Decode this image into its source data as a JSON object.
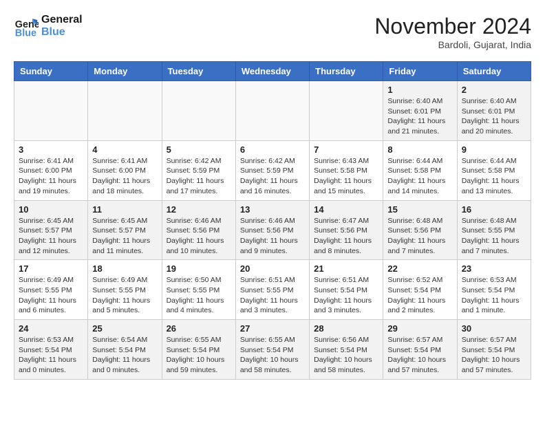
{
  "header": {
    "logo_line1": "General",
    "logo_line2": "Blue",
    "month_title": "November 2024",
    "location": "Bardoli, Gujarat, India"
  },
  "weekdays": [
    "Sunday",
    "Monday",
    "Tuesday",
    "Wednesday",
    "Thursday",
    "Friday",
    "Saturday"
  ],
  "weeks": [
    [
      {
        "day": "",
        "info": ""
      },
      {
        "day": "",
        "info": ""
      },
      {
        "day": "",
        "info": ""
      },
      {
        "day": "",
        "info": ""
      },
      {
        "day": "",
        "info": ""
      },
      {
        "day": "1",
        "info": "Sunrise: 6:40 AM\nSunset: 6:01 PM\nDaylight: 11 hours and 21 minutes."
      },
      {
        "day": "2",
        "info": "Sunrise: 6:40 AM\nSunset: 6:01 PM\nDaylight: 11 hours and 20 minutes."
      }
    ],
    [
      {
        "day": "3",
        "info": "Sunrise: 6:41 AM\nSunset: 6:00 PM\nDaylight: 11 hours and 19 minutes."
      },
      {
        "day": "4",
        "info": "Sunrise: 6:41 AM\nSunset: 6:00 PM\nDaylight: 11 hours and 18 minutes."
      },
      {
        "day": "5",
        "info": "Sunrise: 6:42 AM\nSunset: 5:59 PM\nDaylight: 11 hours and 17 minutes."
      },
      {
        "day": "6",
        "info": "Sunrise: 6:42 AM\nSunset: 5:59 PM\nDaylight: 11 hours and 16 minutes."
      },
      {
        "day": "7",
        "info": "Sunrise: 6:43 AM\nSunset: 5:58 PM\nDaylight: 11 hours and 15 minutes."
      },
      {
        "day": "8",
        "info": "Sunrise: 6:44 AM\nSunset: 5:58 PM\nDaylight: 11 hours and 14 minutes."
      },
      {
        "day": "9",
        "info": "Sunrise: 6:44 AM\nSunset: 5:58 PM\nDaylight: 11 hours and 13 minutes."
      }
    ],
    [
      {
        "day": "10",
        "info": "Sunrise: 6:45 AM\nSunset: 5:57 PM\nDaylight: 11 hours and 12 minutes."
      },
      {
        "day": "11",
        "info": "Sunrise: 6:45 AM\nSunset: 5:57 PM\nDaylight: 11 hours and 11 minutes."
      },
      {
        "day": "12",
        "info": "Sunrise: 6:46 AM\nSunset: 5:56 PM\nDaylight: 11 hours and 10 minutes."
      },
      {
        "day": "13",
        "info": "Sunrise: 6:46 AM\nSunset: 5:56 PM\nDaylight: 11 hours and 9 minutes."
      },
      {
        "day": "14",
        "info": "Sunrise: 6:47 AM\nSunset: 5:56 PM\nDaylight: 11 hours and 8 minutes."
      },
      {
        "day": "15",
        "info": "Sunrise: 6:48 AM\nSunset: 5:56 PM\nDaylight: 11 hours and 7 minutes."
      },
      {
        "day": "16",
        "info": "Sunrise: 6:48 AM\nSunset: 5:55 PM\nDaylight: 11 hours and 7 minutes."
      }
    ],
    [
      {
        "day": "17",
        "info": "Sunrise: 6:49 AM\nSunset: 5:55 PM\nDaylight: 11 hours and 6 minutes."
      },
      {
        "day": "18",
        "info": "Sunrise: 6:49 AM\nSunset: 5:55 PM\nDaylight: 11 hours and 5 minutes."
      },
      {
        "day": "19",
        "info": "Sunrise: 6:50 AM\nSunset: 5:55 PM\nDaylight: 11 hours and 4 minutes."
      },
      {
        "day": "20",
        "info": "Sunrise: 6:51 AM\nSunset: 5:55 PM\nDaylight: 11 hours and 3 minutes."
      },
      {
        "day": "21",
        "info": "Sunrise: 6:51 AM\nSunset: 5:54 PM\nDaylight: 11 hours and 3 minutes."
      },
      {
        "day": "22",
        "info": "Sunrise: 6:52 AM\nSunset: 5:54 PM\nDaylight: 11 hours and 2 minutes."
      },
      {
        "day": "23",
        "info": "Sunrise: 6:53 AM\nSunset: 5:54 PM\nDaylight: 11 hours and 1 minute."
      }
    ],
    [
      {
        "day": "24",
        "info": "Sunrise: 6:53 AM\nSunset: 5:54 PM\nDaylight: 11 hours and 0 minutes."
      },
      {
        "day": "25",
        "info": "Sunrise: 6:54 AM\nSunset: 5:54 PM\nDaylight: 11 hours and 0 minutes."
      },
      {
        "day": "26",
        "info": "Sunrise: 6:55 AM\nSunset: 5:54 PM\nDaylight: 10 hours and 59 minutes."
      },
      {
        "day": "27",
        "info": "Sunrise: 6:55 AM\nSunset: 5:54 PM\nDaylight: 10 hours and 58 minutes."
      },
      {
        "day": "28",
        "info": "Sunrise: 6:56 AM\nSunset: 5:54 PM\nDaylight: 10 hours and 58 minutes."
      },
      {
        "day": "29",
        "info": "Sunrise: 6:57 AM\nSunset: 5:54 PM\nDaylight: 10 hours and 57 minutes."
      },
      {
        "day": "30",
        "info": "Sunrise: 6:57 AM\nSunset: 5:54 PM\nDaylight: 10 hours and 57 minutes."
      }
    ]
  ]
}
